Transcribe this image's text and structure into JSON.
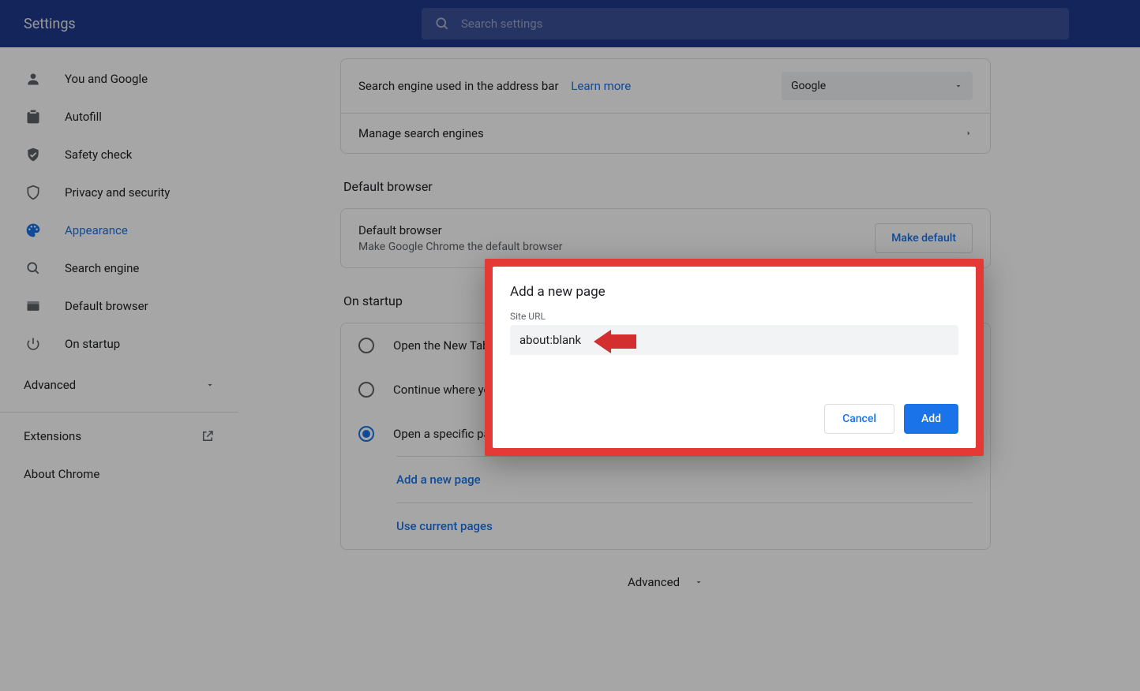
{
  "header": {
    "title": "Settings",
    "search_placeholder": "Search settings"
  },
  "sidebar": {
    "items": [
      {
        "label": "You and Google"
      },
      {
        "label": "Autofill"
      },
      {
        "label": "Safety check"
      },
      {
        "label": "Privacy and security"
      },
      {
        "label": "Appearance"
      },
      {
        "label": "Search engine"
      },
      {
        "label": "Default browser"
      },
      {
        "label": "On startup"
      }
    ],
    "advanced": "Advanced",
    "extensions": "Extensions",
    "about": "About Chrome"
  },
  "search_engine": {
    "row1_label": "Search engine used in the address bar",
    "learn_more": "Learn more",
    "selected": "Google",
    "manage": "Manage search engines"
  },
  "default_browser": {
    "section": "Default browser",
    "title": "Default browser",
    "desc": "Make Google Chrome the default browser",
    "button": "Make default"
  },
  "startup": {
    "section": "On startup",
    "options": [
      {
        "label": "Open the New Tab page"
      },
      {
        "label": "Continue where you left off"
      },
      {
        "label": "Open a specific page or set of pages"
      }
    ],
    "selected_index": 2,
    "add_page": "Add a new page",
    "use_current": "Use current pages"
  },
  "advanced_footer": "Advanced",
  "dialog": {
    "title": "Add a new page",
    "label": "Site URL",
    "value": "about:blank",
    "cancel": "Cancel",
    "add": "Add"
  }
}
